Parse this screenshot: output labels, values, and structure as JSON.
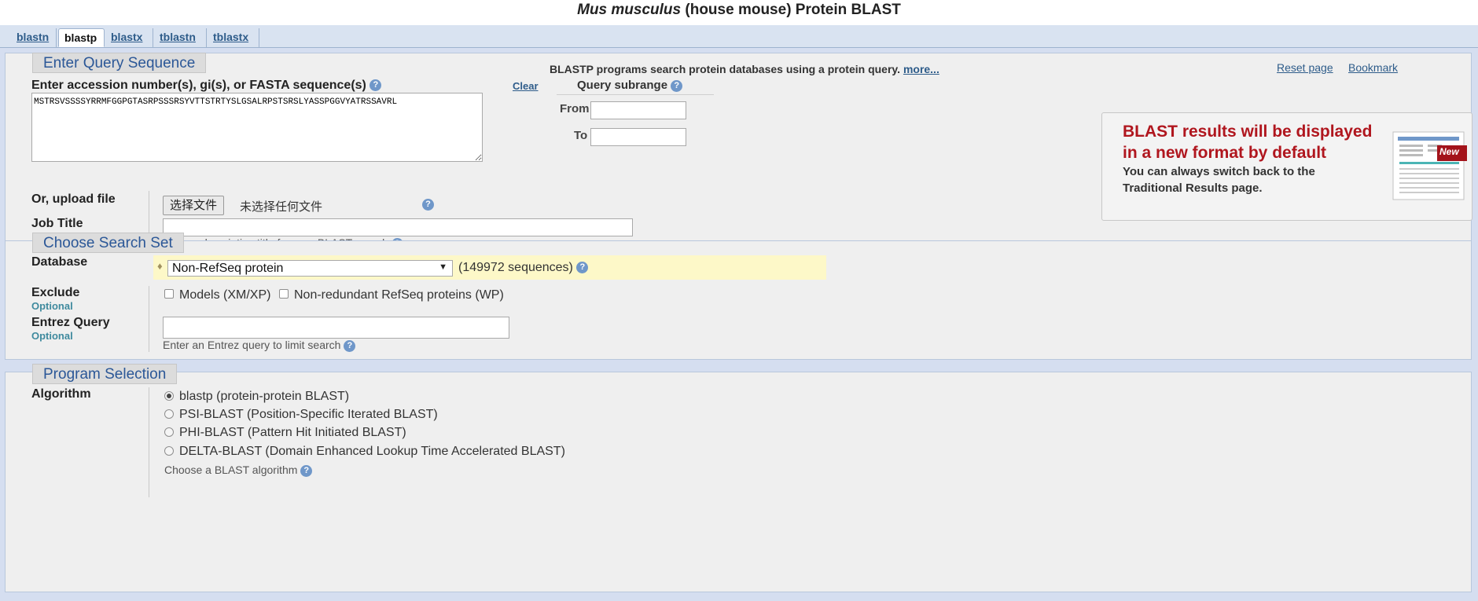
{
  "page_title": {
    "italic": "Mus musculus",
    "rest": "(house mouse) Protein BLAST"
  },
  "tabs": [
    {
      "label": "blastn",
      "active": false
    },
    {
      "label": "blastp",
      "active": true
    },
    {
      "label": "blastx",
      "active": false
    },
    {
      "label": "tblastn",
      "active": false
    },
    {
      "label": "tblastx",
      "active": false
    }
  ],
  "header": {
    "description": "BLASTP programs search protein databases using a protein query.",
    "more_link": "more...",
    "reset_link": "Reset page",
    "bookmark_link": "Bookmark"
  },
  "query_section": {
    "legend": "Enter Query Sequence",
    "sequence_label": "Enter accession number(s), gi(s), or FASTA sequence(s)",
    "clear_link": "Clear",
    "sequence_value": "MSTRSVSSSSYRRMFGGPGTASRPSSSRSYVTTSTRTYSLGSALRPSTSRSLYASSPGGVYATRSSAVRL",
    "subrange_title": "Query subrange",
    "from_label": "From",
    "to_label": "To",
    "from_value": "",
    "to_value": "",
    "upload_label": "Or, upload file",
    "upload_button": "选择文件",
    "upload_status": "未选择任何文件",
    "job_title_label": "Job Title",
    "job_title_value": "",
    "job_title_hint": "Enter a descriptive title for your BLAST search"
  },
  "notice": {
    "title_line1": "BLAST results will be displayed",
    "title_line2": "in a new format by default",
    "body_line1": "You can always switch back to the",
    "body_line2": "Traditional Results page.",
    "badge": "New"
  },
  "search_set": {
    "legend": "Choose Search Set",
    "database_label": "Database",
    "database_selected": "Non-RefSeq protein",
    "database_count": "(149972 sequences)",
    "exclude_label": "Exclude",
    "optional": "Optional",
    "exclude_options": [
      {
        "label": "Models (XM/XP)",
        "checked": false
      },
      {
        "label": "Non-redundant RefSeq proteins (WP)",
        "checked": false
      }
    ],
    "entrez_label": "Entrez Query",
    "entrez_value": "",
    "entrez_hint": "Enter an Entrez query to limit search"
  },
  "program": {
    "legend": "Program Selection",
    "algorithm_label": "Algorithm",
    "options": [
      {
        "label": "blastp (protein-protein BLAST)",
        "selected": true
      },
      {
        "label": "PSI-BLAST (Position-Specific Iterated BLAST)",
        "selected": false
      },
      {
        "label": "PHI-BLAST (Pattern Hit Initiated BLAST)",
        "selected": false
      },
      {
        "label": "DELTA-BLAST (Domain Enhanced Lookup Time Accelerated BLAST)",
        "selected": false
      }
    ],
    "hint": "Choose a BLAST algorithm"
  },
  "colors": {
    "accent_link": "#2e5c8a",
    "legend_text": "#2b5797",
    "notice_title": "#b0161e",
    "database_highlight": "#fdf8c8"
  },
  "icons": {
    "help": "help-circle-icon",
    "dropdown": "triangle-down-icon"
  }
}
